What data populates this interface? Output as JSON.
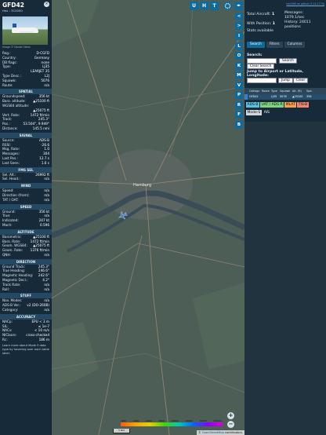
{
  "aircraft": {
    "callsign": "GFD42",
    "hex_line": "Hex : 3C0050",
    "close_glyph": "×",
    "photo_credit": "Image © Daniel Obers",
    "basic": [
      {
        "k": "Reg.:",
        "v": "D-CGFD"
      },
      {
        "k": "Country:",
        "v": "Germany"
      },
      {
        "k": "DB flags:",
        "v": "none"
      },
      {
        "k": "Type:",
        "v": "LJ35"
      },
      {
        "k": "",
        "v": "LEARJET 35"
      },
      {
        "k": "Type Desc.:",
        "v": "L2J"
      },
      {
        "k": "Squawk:",
        "v": "5076"
      },
      {
        "k": "Route:",
        "v": "n/a"
      }
    ],
    "sections": [
      {
        "title": "SPATIAL",
        "rows": [
          {
            "k": "Groundspeed:",
            "v": "356 kt"
          },
          {
            "k": "Baro. altitude:",
            "v": "▲25100 ft"
          },
          {
            "k": "WGS84 altitude:",
            "v": ""
          },
          {
            "k": "",
            "v": "▲25075 ft"
          },
          {
            "k": "Vert. Rate:",
            "v": "1472 ft/min"
          },
          {
            "k": "Track:",
            "v": "245.3°"
          },
          {
            "k": "Pos.:",
            "v": "53.504°, 9.949°"
          },
          {
            "k": "Distance:",
            "v": "145.5 nmi"
          }
        ]
      },
      {
        "title": "SIGNAL",
        "rows": [
          {
            "k": "Source:",
            "v": "ADS-B"
          },
          {
            "k": "RSSI:",
            "v": "-26.6"
          },
          {
            "k": "Msg. Rate:",
            "v": "1.0"
          },
          {
            "k": "Messages:",
            "v": "304"
          },
          {
            "k": "Last Pos.:",
            "v": "12.7 s"
          },
          {
            "k": "Last Seen:",
            "v": "1.6 s"
          }
        ]
      },
      {
        "title": "FMS SEL",
        "rows": [
          {
            "k": "Sel. Alt.:",
            "v": "26992 ft"
          },
          {
            "k": "Sel. Head.:",
            "v": "n/a"
          }
        ]
      },
      {
        "title": "WIND",
        "rows": [
          {
            "k": "Speed:",
            "v": "n/a"
          },
          {
            "k": "Direction (from):",
            "v": "n/a"
          },
          {
            "k": "TAT / OAT:",
            "v": "n/a"
          }
        ]
      },
      {
        "title": "SPEED",
        "rows": [
          {
            "k": "Ground:",
            "v": "356 kt"
          },
          {
            "k": "True:",
            "v": "n/a"
          },
          {
            "k": "Indicated:",
            "v": "247 kt"
          },
          {
            "k": "Mach:",
            "v": "0.596"
          }
        ]
      },
      {
        "title": "ALTITUDE",
        "rows": [
          {
            "k": "Barometric:",
            "v": "▲25100 ft"
          },
          {
            "k": "Baro. Rate:",
            "v": "1472 ft/min"
          },
          {
            "k": "Geom. WGS84:",
            "v": "▲25075 ft"
          },
          {
            "k": "Geom. Rate:",
            "v": "1376 ft/min"
          },
          {
            "k": "QNH:",
            "v": "n/a"
          }
        ]
      },
      {
        "title": "DIRECTION",
        "rows": [
          {
            "k": "Ground Track:",
            "v": "245.3°"
          },
          {
            "k": "True Heading:",
            "v": "246.6°"
          },
          {
            "k": "Magnetic Heading:",
            "v": "242.6°"
          },
          {
            "k": "Magnetic Decl.:",
            "v": "4.2°"
          },
          {
            "k": "Track Rate:",
            "v": "n/a"
          },
          {
            "k": "Roll:",
            "v": "n/a"
          }
        ]
      },
      {
        "title": "STUFF",
        "rows": [
          {
            "k": "Nav. Modes:",
            "v": "n/a"
          },
          {
            "k": "ADS-B Ver.:",
            "v": "v2 (DO-260B)"
          },
          {
            "k": "Category:",
            "v": "n/a"
          }
        ]
      },
      {
        "title": "ACCURACY",
        "rows": [
          {
            "k": "NACp:",
            "v": "EPU < 3 m"
          },
          {
            "k": "SIL:",
            "v": "≤ 1e-7"
          },
          {
            "k": "NACv:",
            "v": "< 10 m/s"
          },
          {
            "k": "NICbaro:",
            "v": "cross-checked"
          },
          {
            "k": "Rc:",
            "v": "186 m"
          }
        ]
      }
    ],
    "note": "Learn more about Mode S data type by hovering over each table label."
  },
  "map": {
    "city_label": "Hamburg",
    "top_buttons": [
      "U",
      "H",
      "T"
    ],
    "left_arrow": "<",
    "right_arrow": ">",
    "side_buttons": [
      "I",
      "L",
      "O",
      "K",
      "M",
      "V",
      "P",
      "R",
      "F",
      "B"
    ],
    "zoom_in": "+",
    "zoom_out": "−",
    "scale_label": "5 NM",
    "legend_ticks": [
      "2000",
      "4000",
      "6000",
      "8000",
      "10000",
      "20000",
      "30000",
      "40000+"
    ],
    "attribution_prefix": "© ",
    "attribution_link": "OpenStreetMap",
    "attribution_suffix": " contributors.",
    "colors": {
      "aircraft": "#3a7fd4",
      "water": "#3a4c56",
      "land": "#4d5e57",
      "road": "#8a8270"
    }
  },
  "right_panel": {
    "version": "tar1090 on github (3.14.1774)",
    "stats": {
      "total_label": "Total Aircraft:",
      "total_value": "1",
      "position_label": "With Position:",
      "position_value": "1",
      "stats_label": "Stats available",
      "messages_label": "Messages:",
      "messages_value": "1079.1/sec",
      "history_label": "History: 24011",
      "history_unit": "positions"
    },
    "tabs": [
      "Search",
      "Filters",
      "Columns"
    ],
    "search_label": "Search:",
    "search_button": "Search",
    "clear_search_button": "Clear Search",
    "jump_label_1": "Jump to Airport or Latitude,",
    "jump_label_2": "Longitude:",
    "jump_button": "Jump",
    "clear_button": "Clear",
    "columns": [
      "",
      "Callsign",
      "Route",
      "Type",
      "Squawk",
      "Alt. (ft)",
      "Spd."
    ],
    "rows": [
      [
        "",
        "GFD42",
        "",
        "LJ35",
        "5076",
        "▲25100",
        "356"
      ]
    ],
    "sources": [
      {
        "label": "ADS-B",
        "color": "#5bc0de"
      },
      {
        "label": "UAT / ADS-R",
        "color": "#7fd37f"
      },
      {
        "label": "MLAT",
        "color": "#f6a24b"
      },
      {
        "label": "TIS-B",
        "color": "#f0876c"
      }
    ],
    "modes": [
      "Mode-S",
      "AIS"
    ]
  }
}
